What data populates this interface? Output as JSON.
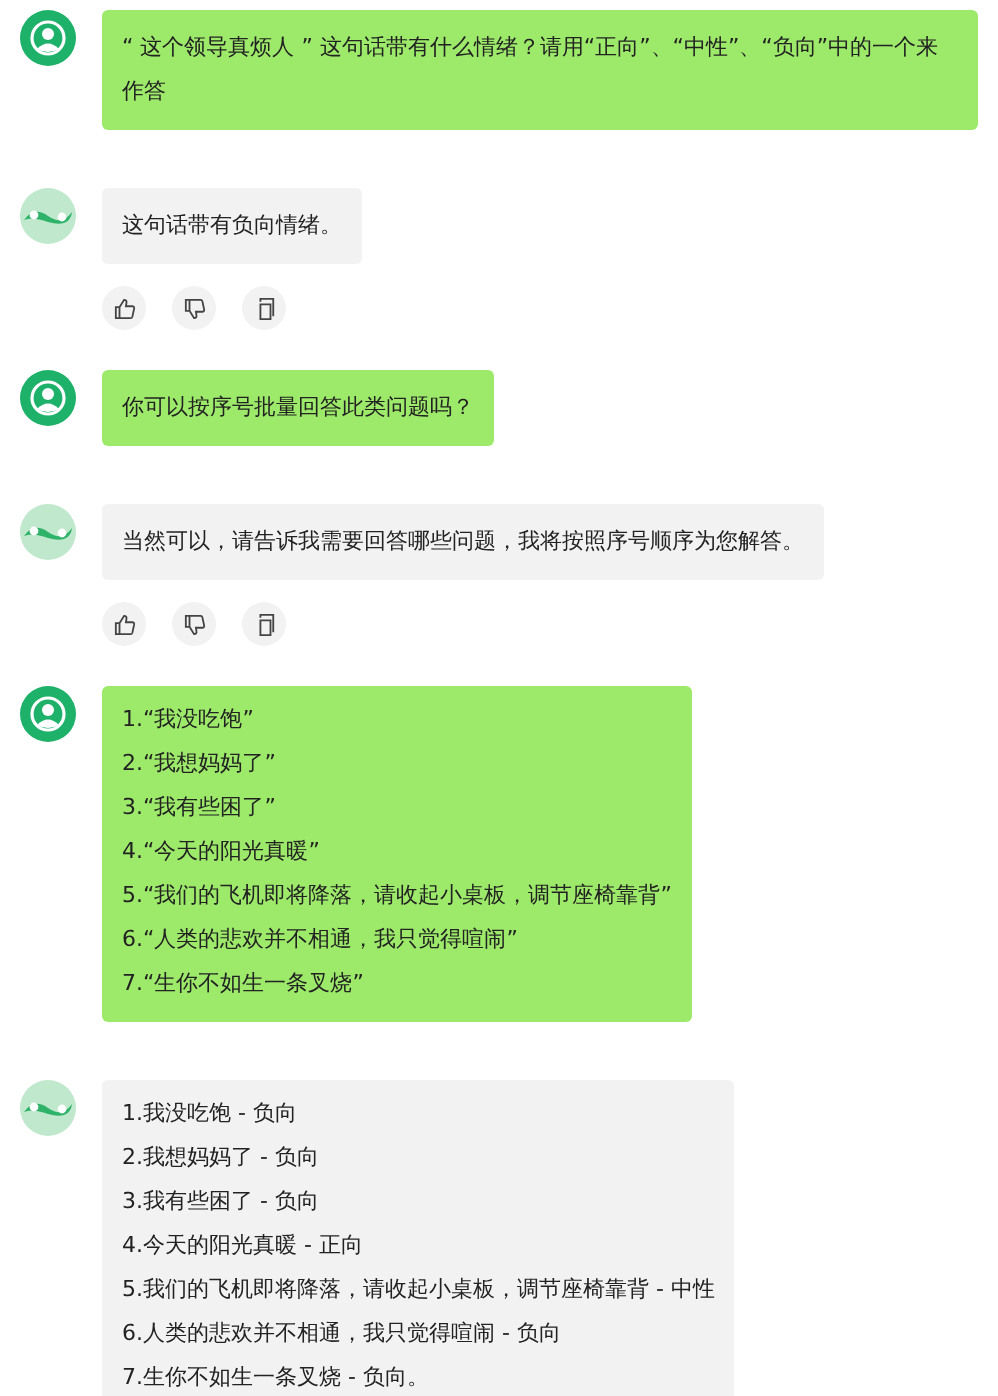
{
  "messages": [
    {
      "kind": "user",
      "lines": [
        "“ 这个领导真烦人 ” 这句话带有什么情绪？请用“正向”、“中性”、“负向”中的一个来作答"
      ]
    },
    {
      "kind": "assistant",
      "lines": [
        "这句话带有负向情绪。"
      ],
      "actions": [
        {
          "kind": "like"
        },
        {
          "kind": "dislike"
        },
        {
          "kind": "copy"
        }
      ]
    },
    {
      "kind": "user",
      "lines": [
        "你可以按序号批量回答此类问题吗？"
      ]
    },
    {
      "kind": "assistant",
      "lines": [
        "当然可以，请告诉我需要回答哪些问题，我将按照序号顺序为您解答。"
      ],
      "actions": [
        {
          "kind": "like"
        },
        {
          "kind": "dislike"
        },
        {
          "kind": "copy"
        }
      ]
    },
    {
      "kind": "user",
      "lines": [
        "1.“我没吃饱”",
        "2.“我想妈妈了”",
        "3.“我有些困了”",
        "4.“今天的阳光真暖”",
        "5.“我们的飞机即将降落，请收起小桌板，调节座椅靠背”",
        "6.“人类的悲欢并不相通，我只觉得喧闹”",
        "7.“生你不如生一条叉烧”"
      ]
    },
    {
      "kind": "assistant",
      "lines": [
        "1.我没吃饱 - 负向",
        "2.我想妈妈了 - 负向",
        "3.我有些困了 - 负向",
        "4.今天的阳光真暖 - 正向",
        "5.我们的飞机即将降落，请收起小桌板，调节座椅靠背 - 中性",
        "6.人类的悲欢并不相通，我只觉得喧闹 - 负向",
        "7.生你不如生一条叉烧 - 负向。"
      ]
    }
  ]
}
